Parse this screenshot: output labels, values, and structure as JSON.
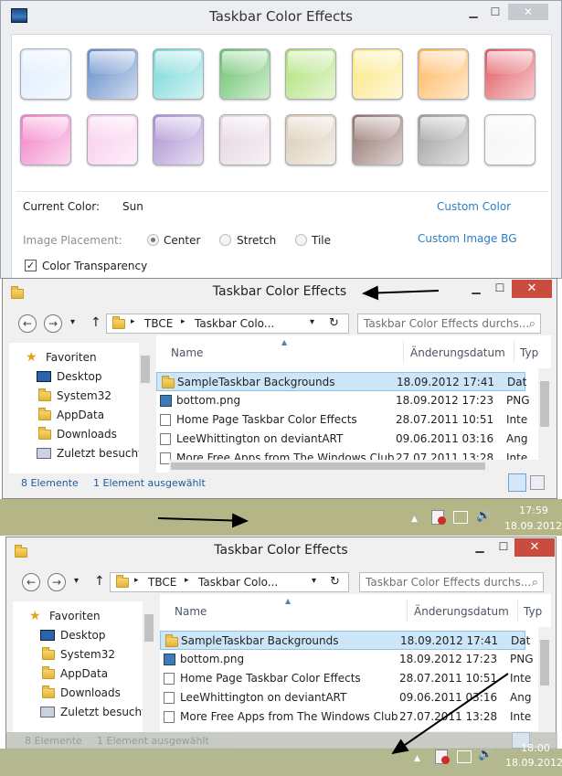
{
  "app": {
    "title": "Taskbar Color Effects",
    "min": "▁",
    "max": "☐",
    "close": "✕",
    "swatches": [
      {
        "color": "#dcecff"
      },
      {
        "color": "#5b86c8"
      },
      {
        "color": "#6fd6d6"
      },
      {
        "color": "#62c063"
      },
      {
        "color": "#a9e070"
      },
      {
        "color": "#fbe57c"
      },
      {
        "color": "#ffb457"
      },
      {
        "color": "#e0535a"
      },
      {
        "color": "#f27bc6"
      },
      {
        "color": "#f7c8ea"
      },
      {
        "color": "#a88bd0"
      },
      {
        "color": "#e4d2e0"
      },
      {
        "color": "#d8c8b0"
      },
      {
        "color": "#8f6c66"
      },
      {
        "color": "#9a9a9a"
      },
      {
        "color": "#f4f4f4"
      }
    ],
    "current_color_label": "Current Color:",
    "current_color_value": "Sun",
    "custom_color": "Custom Color",
    "image_placement_label": "Image Placement:",
    "placement_center": "Center",
    "placement_stretch": "Stretch",
    "placement_tile": "Tile",
    "custom_image_bg": "Custom Image BG",
    "color_transparency": "Color Transparency",
    "check_mark": "✓"
  },
  "explorer": {
    "title": "Taskbar Color Effects",
    "back": "←",
    "forward": "→",
    "dropdown": "▾",
    "up": "↑",
    "breadcrumb_sep": "▸",
    "crumb_root": "TBCE",
    "crumb_current": "Taskbar Colo...",
    "refresh": "↻",
    "search_placeholder": "Taskbar Color Effects durchs...",
    "search_icon": "⌕",
    "nav": {
      "favorites": "Favoriten",
      "items": [
        "Desktop",
        "System32",
        "AppData",
        "Downloads",
        "Zuletzt besucht"
      ]
    },
    "columns": {
      "name": "Name",
      "date": "Änderungsdatum",
      "type": "Typ"
    },
    "files": [
      {
        "name": "SampleTaskbar Backgrounds",
        "date": "18.09.2012 17:41",
        "type": "Dat"
      },
      {
        "name": "bottom.png",
        "date": "18.09.2012 17:23",
        "type": "PNG"
      },
      {
        "name": "Home Page Taskbar Color Effects",
        "date": "28.07.2011 10:51",
        "type": "Inte"
      },
      {
        "name": "LeeWhittington on deviantART",
        "date": "09.06.2011 03:16",
        "type": "Ang"
      },
      {
        "name": "More Free Apps from The Windows Club",
        "date": "27.07.2011 13:28",
        "type": "Inte"
      }
    ],
    "status_count": "8 Elemente",
    "status_selected": "1 Element ausgewählt"
  },
  "taskbar1": {
    "time": "17:59",
    "date": "18.09.2012"
  },
  "taskbar2": {
    "time": "18:00",
    "date": "18.09.2012"
  },
  "tray_icons": {
    "arrow": "▲",
    "volume": "🔊"
  }
}
